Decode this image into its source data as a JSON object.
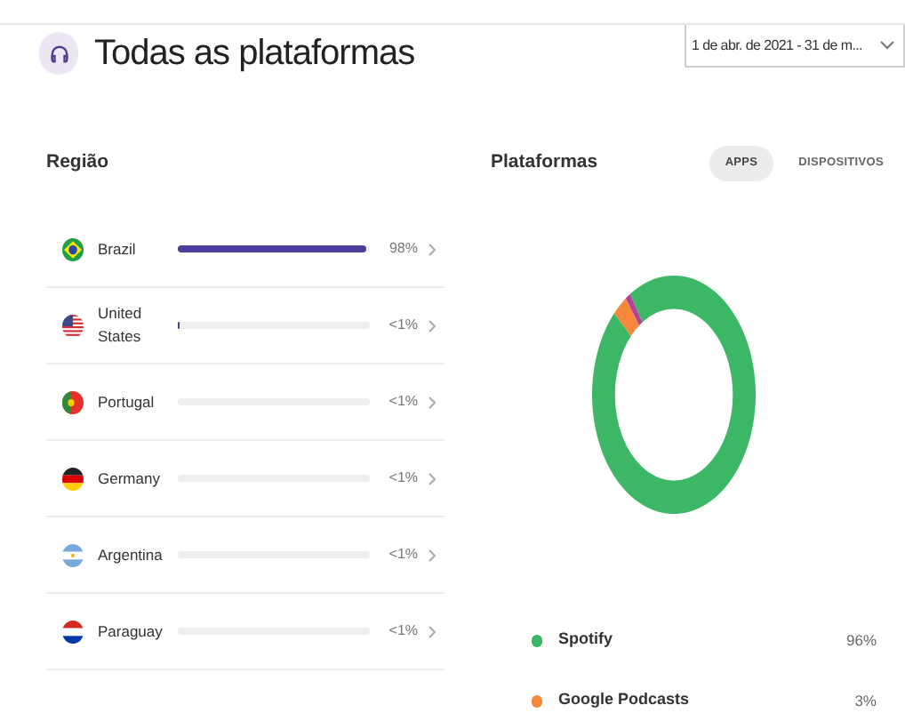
{
  "header": {
    "title": "Todas as plataformas",
    "date_range": "1 de abr. de 2021 - 31 de m..."
  },
  "region": {
    "title": "Região",
    "rows": [
      {
        "kind": "br",
        "name": "Brazil",
        "level": 0.98,
        "reading": "98%"
      },
      {
        "kind": "us",
        "name": "United States",
        "level": 0.01,
        "reading": "<1%"
      },
      {
        "kind": "pt",
        "name": "Portugal",
        "reading": "<1%"
      },
      {
        "kind": "de",
        "name": "Germany",
        "reading": "<1%"
      },
      {
        "kind": "ar",
        "name": "Argentina",
        "reading": "<1%"
      },
      {
        "kind": "py",
        "name": "Paraguay",
        "reading": "<1%"
      }
    ]
  },
  "platforms": {
    "title": "Plataformas",
    "tabs": [
      {
        "label": "APPS",
        "selected": true
      },
      {
        "label": "DISPOSITIVOS",
        "selected": false
      }
    ],
    "legend": [
      {
        "name": "Spotify",
        "value": "96%",
        "color": "#3bb765"
      },
      {
        "name": "Google Podcasts",
        "value": "3%",
        "color": "#f5883a"
      }
    ]
  }
}
